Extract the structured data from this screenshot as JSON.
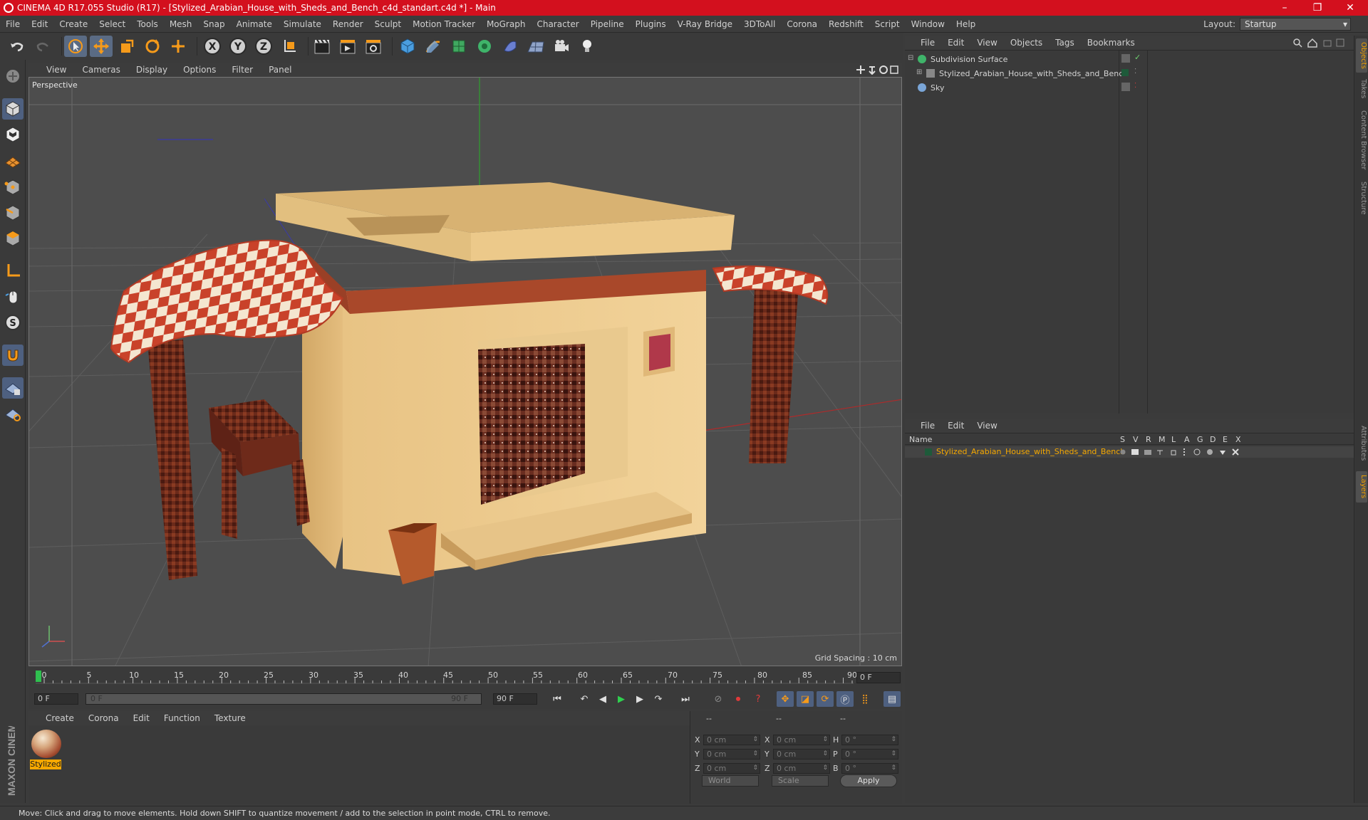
{
  "window": {
    "title": "CINEMA 4D R17.055 Studio (R17) - [Stylized_Arabian_House_with_Sheds_and_Bench_c4d_standart.c4d *] - Main",
    "controls": [
      "–",
      "❐",
      "✕"
    ]
  },
  "menubar": {
    "items": [
      "File",
      "Edit",
      "Create",
      "Select",
      "Tools",
      "Mesh",
      "Snap",
      "Animate",
      "Simulate",
      "Render",
      "Sculpt",
      "Motion Tracker",
      "MoGraph",
      "Character",
      "Pipeline",
      "Plugins",
      "V-Ray Bridge",
      "3DToAll",
      "Corona",
      "Redshift",
      "Script",
      "Window",
      "Help"
    ],
    "layout_label": "Layout:",
    "layout_value": "Startup"
  },
  "toolbar": {
    "axis_x": "X",
    "axis_y": "Y",
    "axis_z": "Z"
  },
  "viewport": {
    "menu": [
      "View",
      "Cameras",
      "Display",
      "Options",
      "Filter",
      "Panel"
    ],
    "camera_label": "Perspective",
    "grid_spacing": "Grid Spacing : 10 cm"
  },
  "timeline": {
    "ticks": [
      "0",
      "5",
      "10",
      "15",
      "20",
      "25",
      "30",
      "35",
      "40",
      "45",
      "50",
      "55",
      "60",
      "65",
      "70",
      "75",
      "80",
      "85",
      "90"
    ],
    "current_frame": "0 F",
    "start_field": "0 F",
    "range_start": "0 F",
    "range_end": "90 F",
    "end_field": "90 F"
  },
  "materials": {
    "menu": [
      "Create",
      "Corona",
      "Edit",
      "Function",
      "Texture"
    ],
    "items": [
      {
        "name": "Stylized"
      }
    ]
  },
  "coordinates": {
    "headers": [
      "--",
      "--",
      "--"
    ],
    "rows": [
      {
        "a": "X",
        "av": "0 cm",
        "b": "X",
        "bv": "0 cm",
        "c": "H",
        "cv": "0 °"
      },
      {
        "a": "Y",
        "av": "0 cm",
        "b": "Y",
        "bv": "0 cm",
        "c": "P",
        "cv": "0 °"
      },
      {
        "a": "Z",
        "av": "0 cm",
        "b": "Z",
        "bv": "0 cm",
        "c": "B",
        "cv": "0 °"
      }
    ],
    "space": "World",
    "mode": "Scale",
    "apply": "Apply"
  },
  "object_manager": {
    "menu": [
      "File",
      "Edit",
      "View",
      "Objects",
      "Tags",
      "Bookmarks"
    ],
    "objects": [
      {
        "name": "Subdivision Surface"
      },
      {
        "name": "Stylized_Arabian_House_with_Sheds_and_Bench"
      },
      {
        "name": "Sky"
      }
    ]
  },
  "layer_manager": {
    "menu": [
      "File",
      "Edit",
      "View"
    ],
    "columns": [
      "Name",
      "S",
      "V",
      "R",
      "M",
      "L",
      "A",
      "G",
      "D",
      "E",
      "X"
    ],
    "layers": [
      {
        "name": "Stylized_Arabian_House_with_Sheds_and_Bench"
      }
    ]
  },
  "right_tabs": [
    "Objects",
    "Takes",
    "Content Browser",
    "Structure",
    "Attributes",
    "Layers"
  ],
  "status": "Move: Click and drag to move elements. Hold down SHIFT to quantize movement / add to the selection in point mode, CTRL to remove.",
  "branding": "MAXON CINEMA 4D",
  "colors": {
    "titlebar": "#d3101e",
    "accent_orange": "#f5a800",
    "selected_tool": "#5a6b84",
    "viewport_bg": "#4d4d4d"
  }
}
